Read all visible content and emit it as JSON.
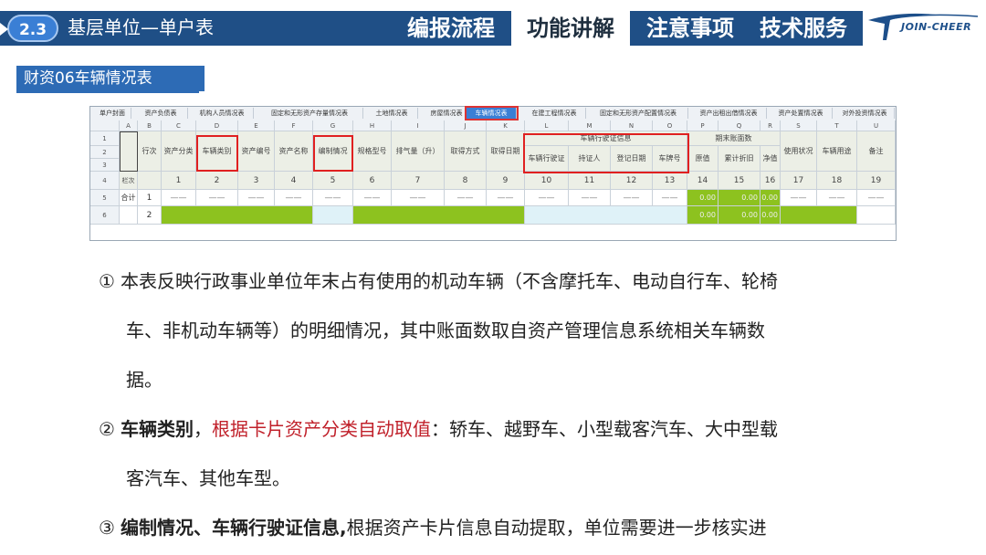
{
  "header": {
    "section_num": "2.3",
    "title": "基层单位—单户表",
    "tabs": [
      {
        "label": "编报流程",
        "active": false
      },
      {
        "label": "功能讲解",
        "active": true
      },
      {
        "label": "注意事项",
        "active": false
      },
      {
        "label": "技术服务",
        "active": false
      }
    ],
    "logo_text": "JOIN-CHEER"
  },
  "subtitle": "财资06车辆情况表",
  "sheet": {
    "tabs": [
      "单户封面",
      "资产负债表",
      "机构人员情况表",
      "固定和无形资产存量情况表",
      "土地情况表",
      "房屋情况表",
      "车辆情况表",
      "在建工程情况表",
      "固定和无形资产配置情况表",
      "资产出租出借情况表",
      "资产处置情况表",
      "对外投资情况表"
    ],
    "active_tab": "车辆情况表",
    "columns": [
      "A",
      "B",
      "C",
      "D",
      "E",
      "F",
      "G",
      "H",
      "I",
      "J",
      "K",
      "L",
      "M",
      "N",
      "O",
      "P",
      "Q",
      "R",
      "S",
      "T",
      "U"
    ],
    "row_numbers": [
      "1",
      "2",
      "3",
      "4",
      "5",
      "6"
    ],
    "header_labels": {
      "B": "行次",
      "C": "资产分类",
      "D": "车辆类别",
      "E": "资产编号",
      "F": "资产名称",
      "G": "编制情况",
      "H": "规格型号",
      "I": "排气量（升）",
      "J": "取得方式",
      "K": "取得日期",
      "LO": "车辆行驶证信息",
      "L": "车辆行驶证",
      "M": "持证人",
      "N": "登记日期",
      "O": "车牌号",
      "PR": "期末账面数",
      "P": "原值",
      "Q": "累计折旧",
      "R": "净值",
      "S": "使用状况",
      "T": "车辆用途",
      "U": "备注"
    },
    "row4": {
      "A": "栏次",
      "nums": [
        "1",
        "2",
        "3",
        "4",
        "5",
        "6",
        "7",
        "8",
        "9",
        "10",
        "11",
        "12",
        "13",
        "14",
        "15",
        "16",
        "17",
        "18",
        "19"
      ]
    },
    "row5": {
      "A": "合计",
      "B": "1",
      "dash": "——",
      "P": "0.00",
      "Q": "0.00",
      "R": "0.00"
    },
    "row6": {
      "B": "2",
      "P": "0.00",
      "Q": "0.00",
      "R": "0.00"
    }
  },
  "paragraphs": {
    "p1_num": "①",
    "p1_line1": "本表反映行政事业单位年末占有使用的机动车辆（不含摩托车、电动自行车、轮椅",
    "p1_line2": "车、非机动车辆等）的明细情况，其中账面数取自资产管理信息系统相关车辆数",
    "p1_line3": "据。",
    "p2_num": "②",
    "p2_bold": "车辆类别",
    "p2_comma": "，",
    "p2_red": "根据卡片资产分类自动取值",
    "p2_rest": "：轿车、越野车、小型载客汽车、大中型载",
    "p2_line2": "客汽车、其他车型。",
    "p3_num": "③",
    "p3_bold": "编制情况、车辆行驶证信息,",
    "p3_rest": "根据资产卡片信息自动提取，单位需要进一步核实进"
  },
  "colors": {
    "brand_blue": "#1f4f86",
    "accent_green": "#8dc21f",
    "highlight_red": "#e02020"
  }
}
